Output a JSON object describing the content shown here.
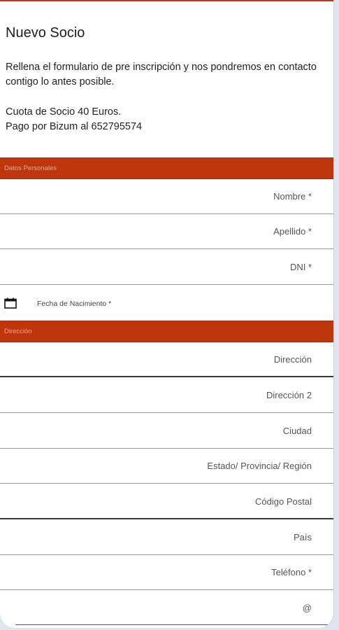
{
  "page": {
    "title": "Nuevo Socio",
    "intro": "Rellena el formulario de pre inscripción y nos pondremos en contacto contigo lo antes posible.",
    "fee_line1": "Cuota de Socio 40 Euros.",
    "fee_line2": "Pago por Bizum al 652795574"
  },
  "sections": {
    "personal": "Datos Personales",
    "address": "Dirección"
  },
  "personal_fields": {
    "nombre": "Nombre *",
    "apellido": "Apellido *",
    "dni": "DNI *",
    "fecha": "Fecha de Nacimiento *"
  },
  "address_fields": {
    "direccion": "Dirección",
    "direccion2": "Dirección 2",
    "ciudad": "Ciudad",
    "estado": "Estado/ Provincia/ Región",
    "codigo_postal": "Código Postal",
    "pais": "País",
    "telefono": "Teléfono *",
    "email": "@"
  },
  "colors": {
    "accent": "#bf360c",
    "background": "#dfe6f0"
  },
  "icons": {
    "date": "calendar-icon"
  }
}
